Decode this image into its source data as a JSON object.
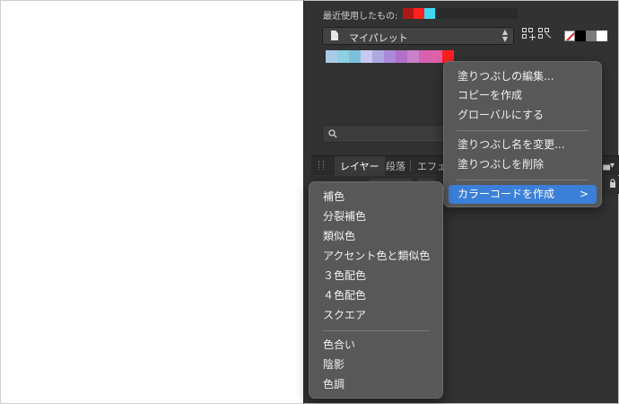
{
  "recent": {
    "label": "最近使用したもの:",
    "swatches": [
      "#b01818",
      "#ff2020",
      "#3fd8f0"
    ]
  },
  "palette": {
    "name": "マイパレット",
    "swatches": [
      "#a8cce8",
      "#8ecfe2",
      "#7cc0da",
      "#c8c8f0",
      "#b0a8e0",
      "#a88ad8",
      "#b070c8",
      "#c880c8",
      "#d860b0",
      "#e060a8",
      "#ff2020"
    ]
  },
  "fill_colors": [
    "#000000",
    "#7a7a7a",
    "#ffffff"
  ],
  "tabs": {
    "active": "レイヤー",
    "second": "段落",
    "third": "エフェ"
  },
  "context_menu": {
    "items": [
      "塗りつぶしの編集...",
      "コピーを作成",
      "グローバルにする",
      "塗りつぶし名を変更...",
      "塗りつぶしを削除",
      "カラーコードを作成"
    ],
    "highlight_chevron": ">"
  },
  "submenu": {
    "items": [
      "補色",
      "分裂補色",
      "類似色",
      "アクセント色と類似色",
      "３色配色",
      "４色配色",
      "スクエア",
      "色合い",
      "陰影",
      "色調"
    ]
  },
  "icons": {
    "document": "document-icon",
    "stepper": "up-down-arrows-icon",
    "qr_add": "qr-add-icon",
    "qr_remove": "qr-remove-icon",
    "search": "search-icon",
    "lock": "lock-icon",
    "panel_menu": "panel-menu-icon"
  }
}
